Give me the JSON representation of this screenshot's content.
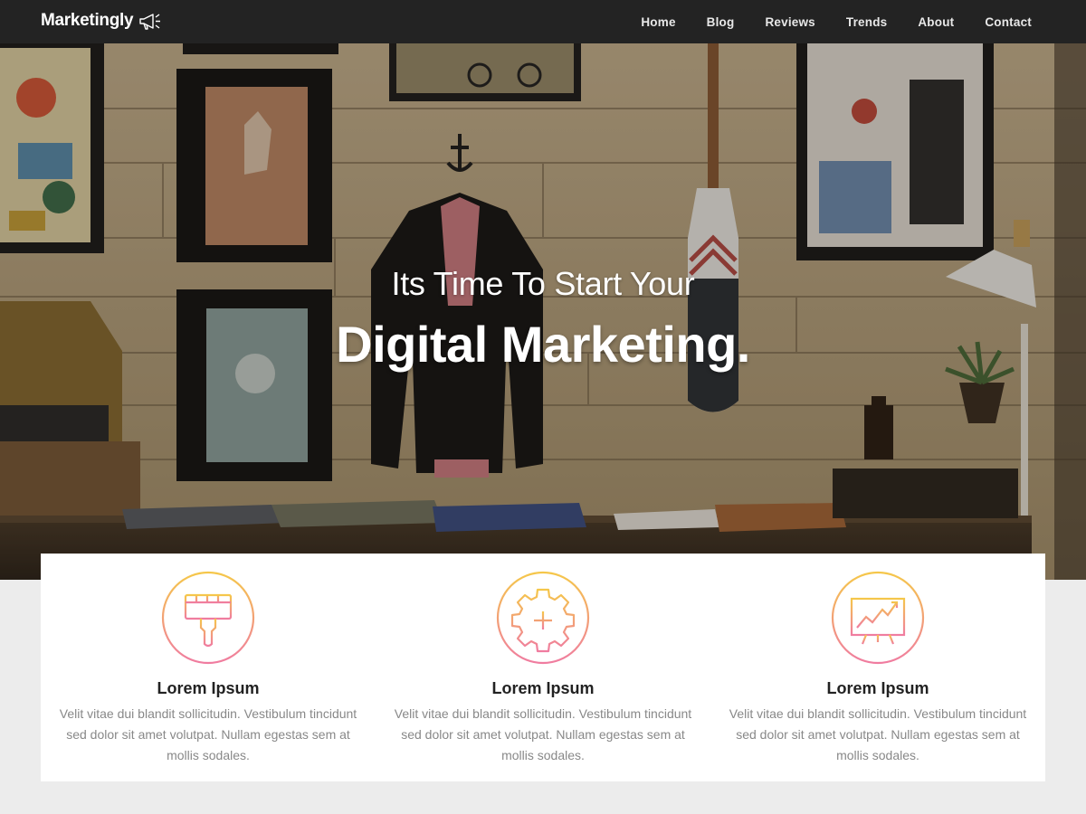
{
  "brand": {
    "name": "Marketingly",
    "icon": "megaphone-icon"
  },
  "nav": {
    "items": [
      {
        "label": "Home"
      },
      {
        "label": "Blog"
      },
      {
        "label": "Reviews"
      },
      {
        "label": "Trends"
      },
      {
        "label": "About"
      },
      {
        "label": "Contact"
      }
    ]
  },
  "hero": {
    "subtitle": "Its Time To Start Your",
    "title": "Digital Marketing."
  },
  "features": [
    {
      "icon": "paintbrush-icon",
      "title": "Lorem Ipsum",
      "text": "Velit vitae dui blandit sollicitudin. Vestibulum tincidunt sed dolor sit amet volutpat. Nullam egestas sem at mollis sodales."
    },
    {
      "icon": "gear-plus-icon",
      "title": "Lorem Ipsum",
      "text": "Velit vitae dui blandit sollicitudin. Vestibulum tincidunt sed dolor sit amet volutpat. Nullam egestas sem at mollis sodales."
    },
    {
      "icon": "chart-board-icon",
      "title": "Lorem Ipsum",
      "text": "Velit vitae dui blandit sollicitudin. Vestibulum tincidunt sed dolor sit amet volutpat. Nullam egestas sem at mollis sodales."
    }
  ],
  "colors": {
    "navbar": "#232323",
    "icon_gradient_start": "#f5c74a",
    "icon_gradient_end": "#f07ca0",
    "page_bg": "#ececec"
  }
}
